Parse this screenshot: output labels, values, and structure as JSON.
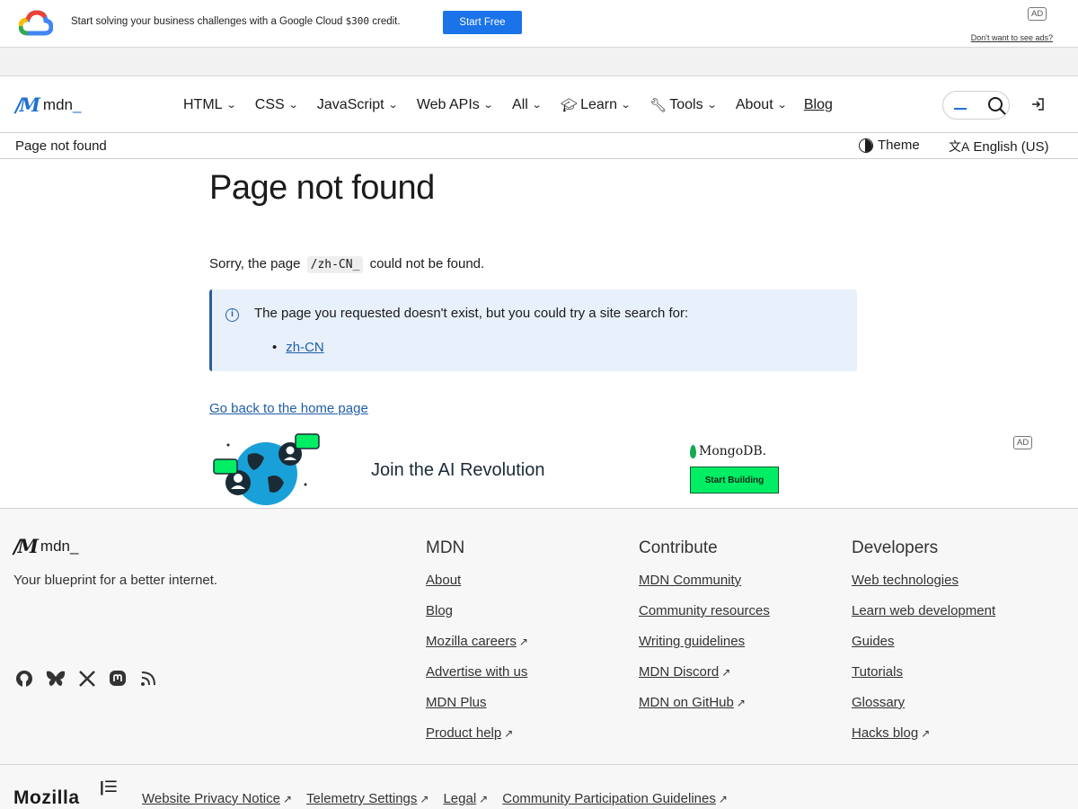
{
  "top_ad": {
    "text_pre": "Start solving your business challenges with a Google Cloud ",
    "text_code": "$300",
    "text_post": " credit.",
    "button": "Start Free",
    "ad_label": "AD",
    "dont_want": "Don't want to see ads?"
  },
  "header": {
    "logo_text": "mdn",
    "nav": [
      {
        "label": "HTML"
      },
      {
        "label": "CSS"
      },
      {
        "label": "JavaScript"
      },
      {
        "label": "Web APIs"
      },
      {
        "label": "All"
      },
      {
        "label": "Learn",
        "icon": "graduation-cap-icon"
      },
      {
        "label": "Tools",
        "icon": "wrench-icon"
      },
      {
        "label": "About"
      }
    ],
    "blog": "Blog"
  },
  "breadcrumb": {
    "current": "Page not found",
    "theme": "Theme",
    "language": "English (US)"
  },
  "main": {
    "title": "Page not found",
    "sorry_pre": "Sorry, the page ",
    "sorry_code": "/zh-CN_",
    "sorry_post": " could not be found.",
    "notice_text": "The page you requested doesn't exist, but you could try a site search for:",
    "notice_link": "zh-CN",
    "home_link": "Go back to the home page"
  },
  "mongo_ad": {
    "slogan": "Join the AI Revolution",
    "brand": "MongoDB.",
    "button": "Start Building",
    "ad_label": "AD"
  },
  "footer": {
    "logo_text": "mdn",
    "tagline": "Your blueprint for a better internet.",
    "columns": [
      {
        "heading": "MDN",
        "links": [
          "About",
          "Blog",
          "Mozilla careers",
          "Advertise with us",
          "MDN Plus",
          "Product help"
        ]
      },
      {
        "heading": "Contribute",
        "links": [
          "MDN Community",
          "Community resources",
          "Writing guidelines",
          "MDN Discord",
          "MDN on GitHub"
        ]
      },
      {
        "heading": "Developers",
        "links": [
          "Web technologies",
          "Learn web development",
          "Guides",
          "Tutorials",
          "Glossary",
          "Hacks blog"
        ]
      }
    ],
    "mozilla": "Mozilla",
    "legal": [
      "Website Privacy Notice",
      "Telemetry Settings",
      "Legal",
      "Community Participation Guidelines"
    ]
  }
}
